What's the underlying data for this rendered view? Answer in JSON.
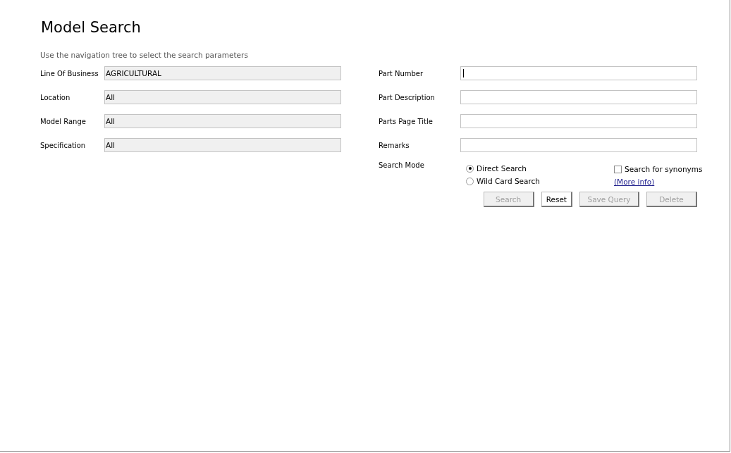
{
  "title": "Model Search",
  "instructions": "Use the navigation tree to select the search parameters",
  "parameters": [
    {
      "label": "Line Of Business",
      "value": "AGRICULTURAL"
    },
    {
      "label": "Location",
      "value": "All"
    },
    {
      "label": "Model Range",
      "value": "All"
    },
    {
      "label": "Specification",
      "value": "All"
    }
  ],
  "search_fields": [
    {
      "label": "Part Number",
      "focused": true
    },
    {
      "label": "Part Description",
      "focused": false
    },
    {
      "label": "Parts Page Title",
      "focused": false
    },
    {
      "label": "Remarks",
      "focused": false
    }
  ],
  "search_mode": {
    "label": "Search Mode",
    "options": [
      {
        "label": "Direct Search",
        "selected": true
      },
      {
        "label": "Wild Card Search",
        "selected": false
      }
    ],
    "synonyms": {
      "label": "Search for synonyms",
      "checked": false
    },
    "more_info": "(More info)"
  },
  "buttons": [
    {
      "label": "Search",
      "disabled": true
    },
    {
      "label": "Reset",
      "disabled": false
    },
    {
      "label": "Save Query",
      "disabled": true
    },
    {
      "label": "Delete",
      "disabled": true
    }
  ]
}
